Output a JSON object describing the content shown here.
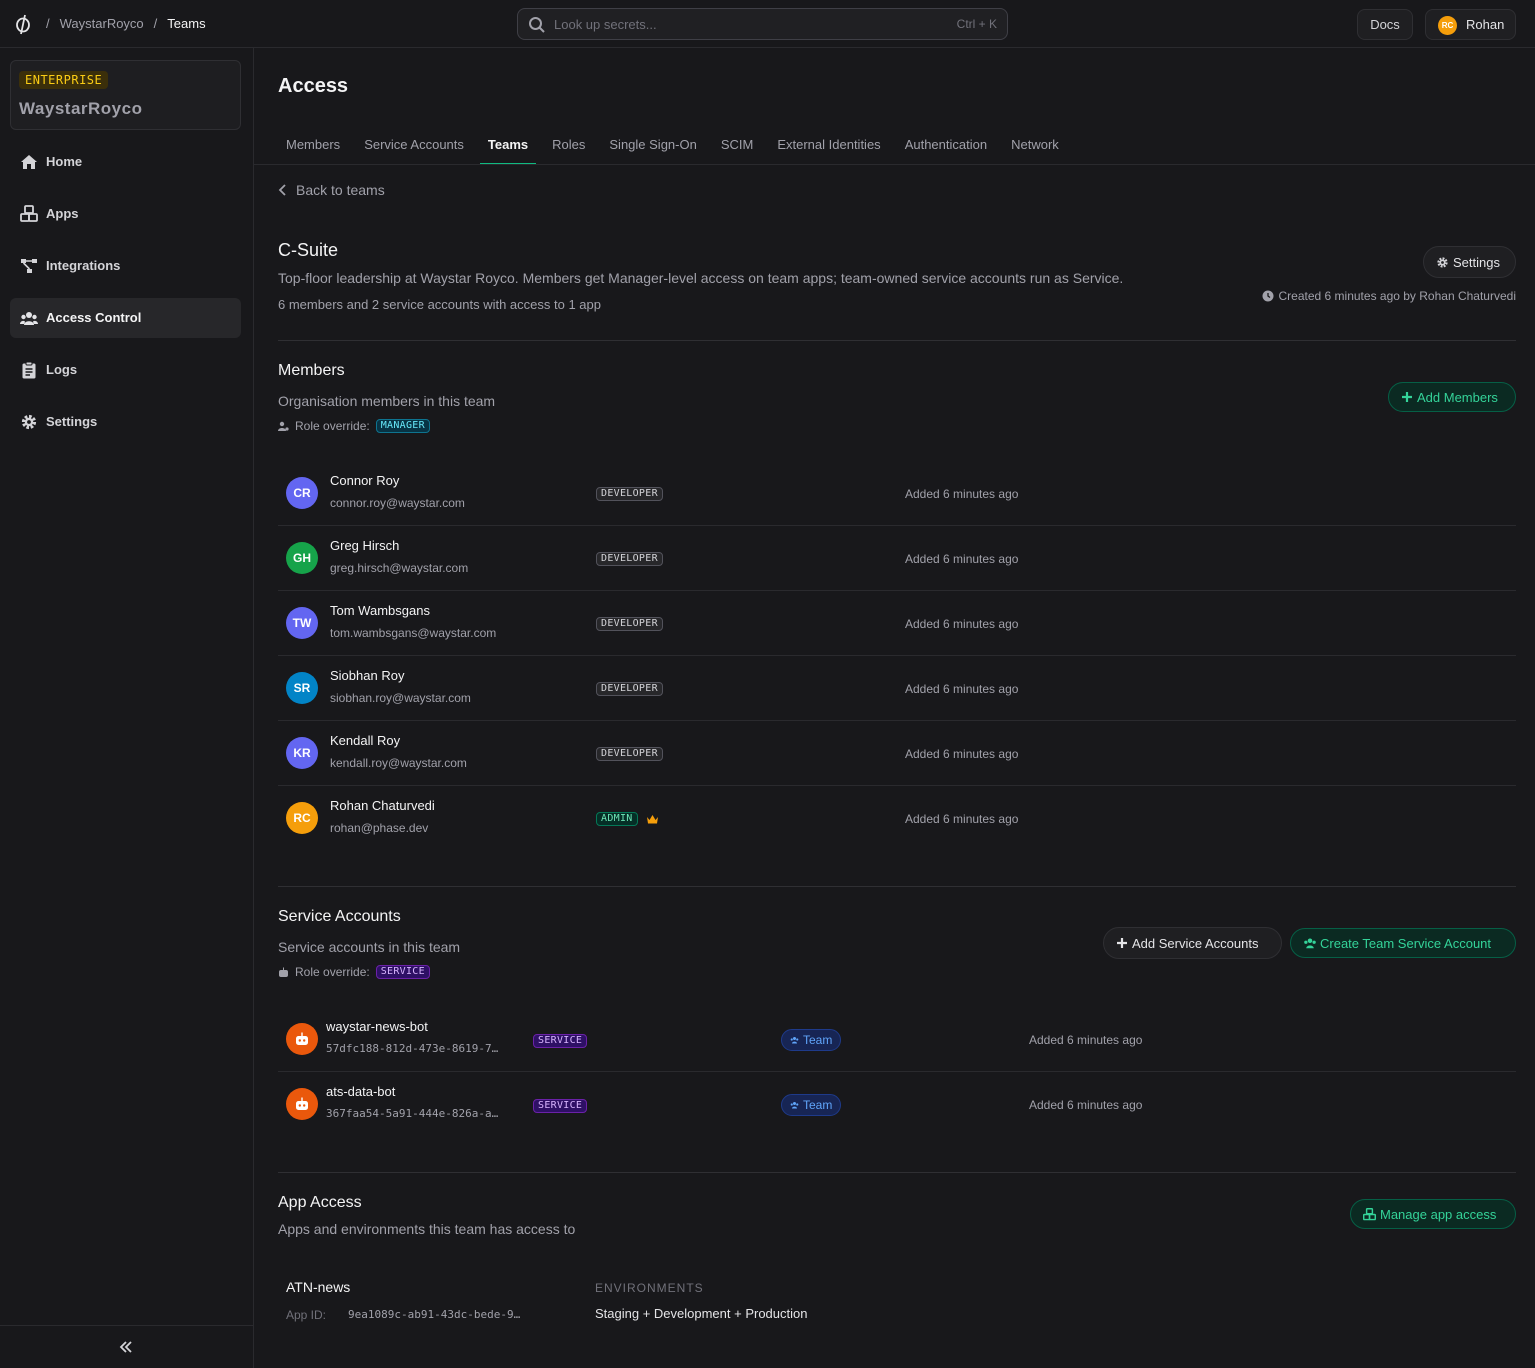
{
  "breadcrumb": {
    "org": "WaystarRoyco",
    "current": "Teams",
    "separator": "/"
  },
  "search": {
    "placeholder": "Look up secrets...",
    "shortcut": "Ctrl + K"
  },
  "header": {
    "docs_label": "Docs",
    "user_initials": "RC",
    "user_name": "Rohan"
  },
  "sidebar": {
    "plan_badge": "ENTERPRISE",
    "org_name": "WaystarRoyco",
    "items": [
      {
        "label": "Home",
        "icon": "home-icon",
        "active": false
      },
      {
        "label": "Apps",
        "icon": "apps-icon",
        "active": false
      },
      {
        "label": "Integrations",
        "icon": "integrations-icon",
        "active": false
      },
      {
        "label": "Access Control",
        "icon": "users-icon",
        "active": true
      },
      {
        "label": "Logs",
        "icon": "clipboard-icon",
        "active": false
      },
      {
        "label": "Settings",
        "icon": "gear-icon",
        "active": false
      }
    ],
    "collapse_icon": "chevrons-left-icon"
  },
  "page": {
    "title": "Access",
    "tabs": [
      "Members",
      "Service Accounts",
      "Teams",
      "Roles",
      "Single Sign-On",
      "SCIM",
      "External Identities",
      "Authentication",
      "Network"
    ],
    "active_tab": "Teams",
    "back_label": "Back to teams"
  },
  "team": {
    "name": "C-Suite",
    "description": "Top-floor leadership at Waystar Royco. Members get Manager-level access on team apps; team-owned service accounts run as Service.",
    "summary": "6 members and 2 service accounts with access to 1 app",
    "settings_label": "Settings",
    "created": "Created 6 minutes ago by Rohan Chaturvedi"
  },
  "members": {
    "title": "Members",
    "subtitle": "Organisation members in this team",
    "override_label": "Role override:",
    "override_role": "MANAGER",
    "add_label": "Add Members",
    "rows": [
      {
        "initials": "CR",
        "name": "Connor Roy",
        "email": "connor.roy@waystar.com",
        "role": "DEVELOPER",
        "added": "Added 6 minutes ago",
        "color": "#6366f1"
      },
      {
        "initials": "GH",
        "name": "Greg Hirsch",
        "email": "greg.hirsch@waystar.com",
        "role": "DEVELOPER",
        "added": "Added 6 minutes ago",
        "color": "#16a34a"
      },
      {
        "initials": "TW",
        "name": "Tom Wambsgans",
        "email": "tom.wambsgans@waystar.com",
        "role": "DEVELOPER",
        "added": "Added 6 minutes ago",
        "color": "#6366f1"
      },
      {
        "initials": "SR",
        "name": "Siobhan Roy",
        "email": "siobhan.roy@waystar.com",
        "role": "DEVELOPER",
        "added": "Added 6 minutes ago",
        "color": "#0284c7"
      },
      {
        "initials": "KR",
        "name": "Kendall Roy",
        "email": "kendall.roy@waystar.com",
        "role": "DEVELOPER",
        "added": "Added 6 minutes ago",
        "color": "#6366f1"
      },
      {
        "initials": "RC",
        "name": "Rohan Chaturvedi",
        "email": "rohan@phase.dev",
        "role": "ADMIN",
        "added": "Added 6 minutes ago",
        "color": "#f59e0b",
        "owner_icon": "crown-icon"
      }
    ]
  },
  "service_accounts": {
    "title": "Service Accounts",
    "subtitle": "Service accounts in this team",
    "override_label": "Role override:",
    "override_role": "SERVICE",
    "add_label": "Add Service Accounts",
    "create_label": "Create Team Service Account",
    "rows": [
      {
        "name": "waystar-news-bot",
        "id": "57dfc188-812d-473e-8619-7…",
        "role": "SERVICE",
        "scope": "Team",
        "added": "Added 6 minutes ago"
      },
      {
        "name": "ats-data-bot",
        "id": "367faa54-5a91-444e-826a-a…",
        "role": "SERVICE",
        "scope": "Team",
        "added": "Added 6 minutes ago"
      }
    ]
  },
  "app_access": {
    "title": "App Access",
    "subtitle": "Apps and environments this team has access to",
    "manage_label": "Manage app access",
    "apps": [
      {
        "name": "ATN-news",
        "id_label": "App ID:",
        "id": "9ea1089c-ab91-43dc-bede-9…",
        "env_label": "ENVIRONMENTS",
        "envs": "Staging + Development + Production"
      }
    ]
  },
  "colors": {
    "accent": "#10b981",
    "background": "#18181b",
    "border": "#2a2a2e"
  }
}
